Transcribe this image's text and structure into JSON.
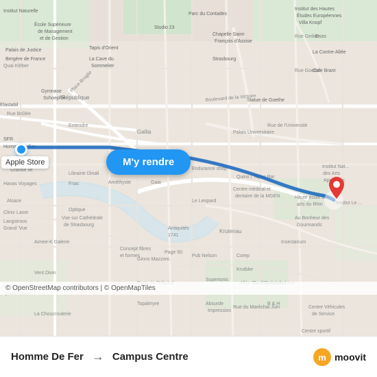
{
  "map": {
    "nav_button_label": "M'y rendre",
    "copyright": "© OpenStreetMap contributors | © OpenMapTiles",
    "apple_store_label": "Apple Store",
    "origin_label": "Homme De Fer",
    "destination_label": "Campus Centre",
    "moovit_label": "moovit"
  },
  "route": {
    "from": "Homme De Fer",
    "to": "Campus Centre",
    "arrow": "→"
  },
  "colors": {
    "route_line": "#1565C0",
    "map_bg": "#e8e0d8",
    "road_major": "#ffffff",
    "road_minor": "#f5f0eb",
    "park": "#c8e6c9",
    "water": "#b3d9f0",
    "button_bg": "#2196F3",
    "marker_red": "#e53935"
  }
}
